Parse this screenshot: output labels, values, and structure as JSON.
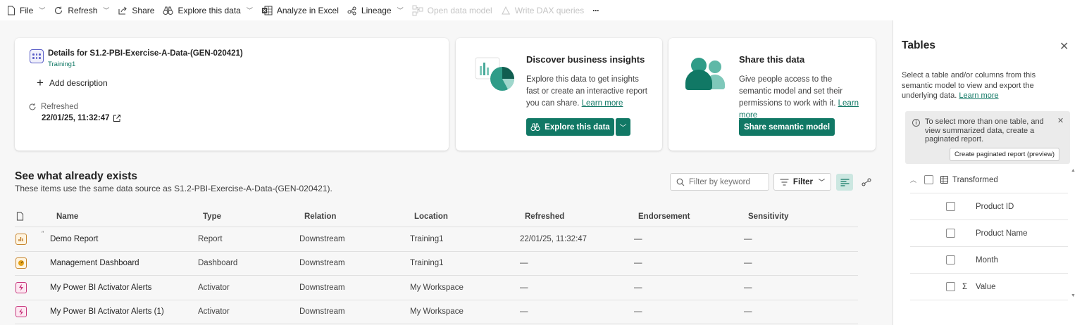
{
  "toolbar": {
    "file": "File",
    "refresh": "Refresh",
    "share": "Share",
    "explore": "Explore this data",
    "analyze": "Analyze in Excel",
    "lineage": "Lineage",
    "open_model": "Open data model",
    "write_dax": "Write DAX queries",
    "more": "···"
  },
  "details": {
    "title": "Details for S1.2-PBI-Exercise-A-Data-(GEN-020421)",
    "workspace": "Training1",
    "add_description": "Add description",
    "refreshed_label": "Refreshed",
    "refreshed_value": "22/01/25, 11:32:47"
  },
  "discover": {
    "title": "Discover business insights",
    "text": "Explore this data to get insights fast or create an interactive report you can share.",
    "link": "Learn more",
    "button": "Explore this data"
  },
  "share": {
    "title": "Share this data",
    "text": "Give people access to the semantic model and set their permissions to work with it.",
    "link": "Learn more",
    "button": "Share semantic model"
  },
  "existing": {
    "title": "See what already exists",
    "subtitle": "These items use the same data source as S1.2-PBI-Exercise-A-Data-(GEN-020421).",
    "filter_placeholder": "Filter by keyword",
    "filter_button": "Filter"
  },
  "table": {
    "headers": [
      "Name",
      "Type",
      "Relation",
      "Location",
      "Refreshed",
      "Endorsement",
      "Sensitivity"
    ],
    "rows": [
      {
        "icon": "report-icon",
        "name": "Demo Report",
        "type": "Report",
        "relation": "Downstream",
        "location": "Training1",
        "refreshed": "22/01/25, 11:32:47",
        "endorsement": "—",
        "sensitivity": "—"
      },
      {
        "icon": "dashboard-icon",
        "name": "Management Dashboard",
        "type": "Dashboard",
        "relation": "Downstream",
        "location": "Training1",
        "refreshed": "—",
        "endorsement": "—",
        "sensitivity": "—"
      },
      {
        "icon": "activator-icon",
        "name": "My Power BI Activator Alerts",
        "type": "Activator",
        "relation": "Downstream",
        "location": "My Workspace",
        "refreshed": "—",
        "endorsement": "—",
        "sensitivity": "—"
      },
      {
        "icon": "activator-icon",
        "name": "My Power BI Activator Alerts (1)",
        "type": "Activator",
        "relation": "Downstream",
        "location": "My Workspace",
        "refreshed": "—",
        "endorsement": "—",
        "sensitivity": "—"
      }
    ]
  },
  "pane": {
    "title": "Tables",
    "description": "Select a table and/or columns from this semantic model to view and export the underlying data.",
    "link": "Learn more",
    "info": "To select more than one table, and view summarized data, create a paginated report.",
    "info_button": "Create paginated report (preview)",
    "table_name": "Transformed",
    "columns": [
      "Product ID",
      "Product Name",
      "Month",
      "Value"
    ]
  },
  "colors": {
    "accent": "#117865",
    "accent_light": "#cce7e1"
  }
}
